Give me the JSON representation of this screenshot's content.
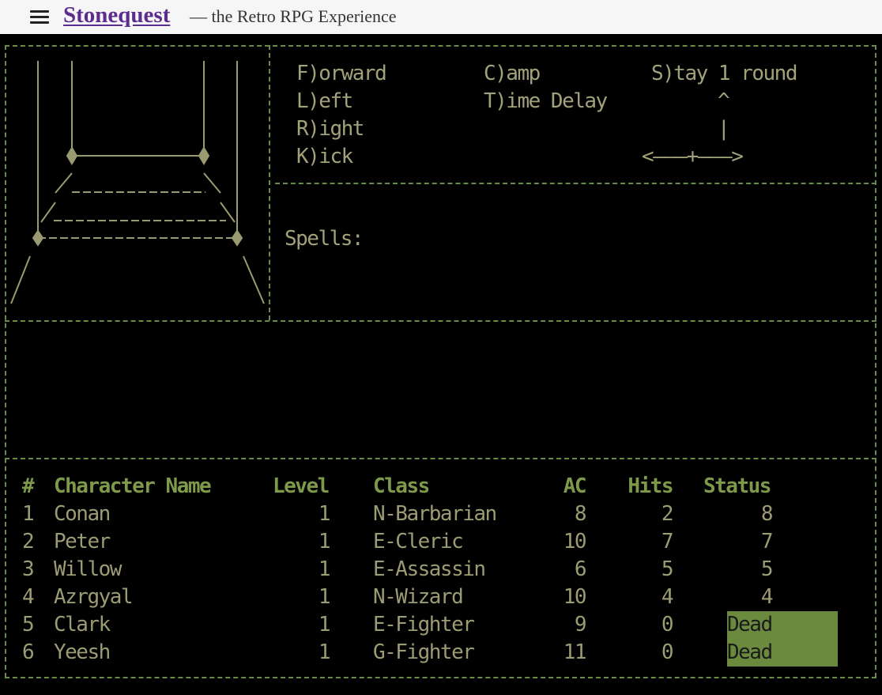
{
  "header": {
    "title": "Stonequest",
    "subtitle": "— the Retro RPG Experience"
  },
  "commands": {
    "forward": "F)orward",
    "left": "L)eft",
    "right": "R)ight",
    "kick": "K)ick",
    "camp": "C)amp",
    "time_delay": "T)ime Delay",
    "stay": "S)tay 1 round",
    "compass_up": "^",
    "compass_stem": "|",
    "compass_horizontal": "<———+———>"
  },
  "spells_label": "Spells:",
  "party": {
    "headers": {
      "num": "#",
      "name": "Character Name",
      "level": "Level",
      "class": "Class",
      "ac": "AC",
      "hits": "Hits",
      "status": "Status"
    },
    "rows": [
      {
        "num": "1",
        "name": "Conan",
        "level": "1",
        "class": "N-Barbarian",
        "ac": "8",
        "hits": "2",
        "status": "8"
      },
      {
        "num": "2",
        "name": "Peter",
        "level": "1",
        "class": "E-Cleric",
        "ac": "10",
        "hits": "7",
        "status": "7"
      },
      {
        "num": "3",
        "name": "Willow",
        "level": "1",
        "class": "E-Assassin",
        "ac": "6",
        "hits": "5",
        "status": "5"
      },
      {
        "num": "4",
        "name": "Azrgyal",
        "level": "1",
        "class": "N-Wizard",
        "ac": "10",
        "hits": "4",
        "status": "4"
      },
      {
        "num": "5",
        "name": "Clark",
        "level": "1",
        "class": "E-Fighter",
        "ac": "9",
        "hits": "0",
        "status": "Dead"
      },
      {
        "num": "6",
        "name": "Yeesh",
        "level": "1",
        "class": "G-Fighter",
        "ac": "11",
        "hits": "0",
        "status": "Dead"
      }
    ]
  },
  "colors": {
    "screen_bg": "#000000",
    "text": "#a2a27a",
    "header_text": "#7d9a4a",
    "dead_highlight": "#6b8a3e",
    "title_link": "#5b2d8e"
  }
}
